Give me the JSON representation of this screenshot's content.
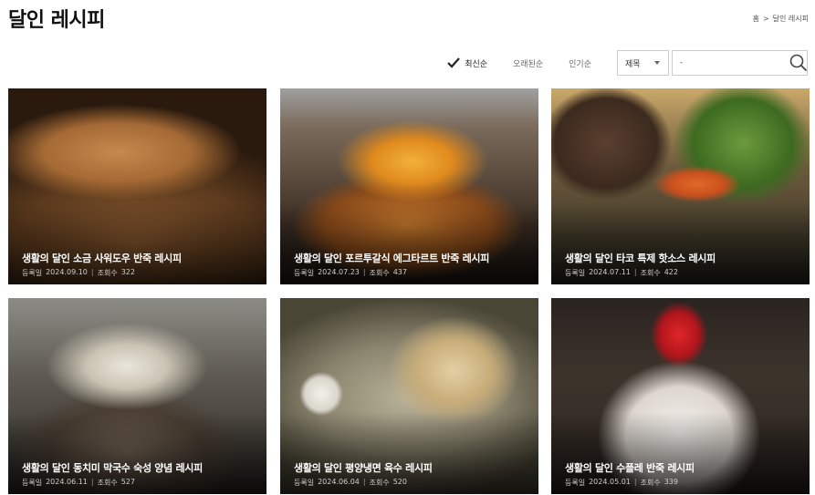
{
  "header": {
    "title": "달인 레시피",
    "breadcrumb": [
      "홈",
      ">",
      "달인 레시피"
    ]
  },
  "toolbar": {
    "sort_options": [
      {
        "label": "최신순",
        "active": true
      },
      {
        "label": "오래된순",
        "active": false
      },
      {
        "label": "인기순",
        "active": false
      }
    ],
    "search_field_select": "제목",
    "search_input_value": "-"
  },
  "meta_labels": {
    "date": "등록일",
    "views": "조회수"
  },
  "cards": [
    {
      "title": "생활의 달인 소금 사워도우 반죽 레시피",
      "date": "2024.09.10",
      "views": "322"
    },
    {
      "title": "생활의 달인 포르투갈식 에그타르트 반죽 레시피",
      "date": "2024.07.23",
      "views": "437"
    },
    {
      "title": "생활의 달인 타코 특제 핫소스 레시피",
      "date": "2024.07.11",
      "views": "422"
    },
    {
      "title": "생활의 달인 동치미 막국수 숙성 양념 레시피",
      "date": "2024.06.11",
      "views": "527"
    },
    {
      "title": "생활의 달인 평양냉면 육수 레시피",
      "date": "2024.06.04",
      "views": "520"
    },
    {
      "title": "생활의 달인 수플레 반죽 레시피",
      "date": "2024.05.01",
      "views": "339"
    }
  ]
}
